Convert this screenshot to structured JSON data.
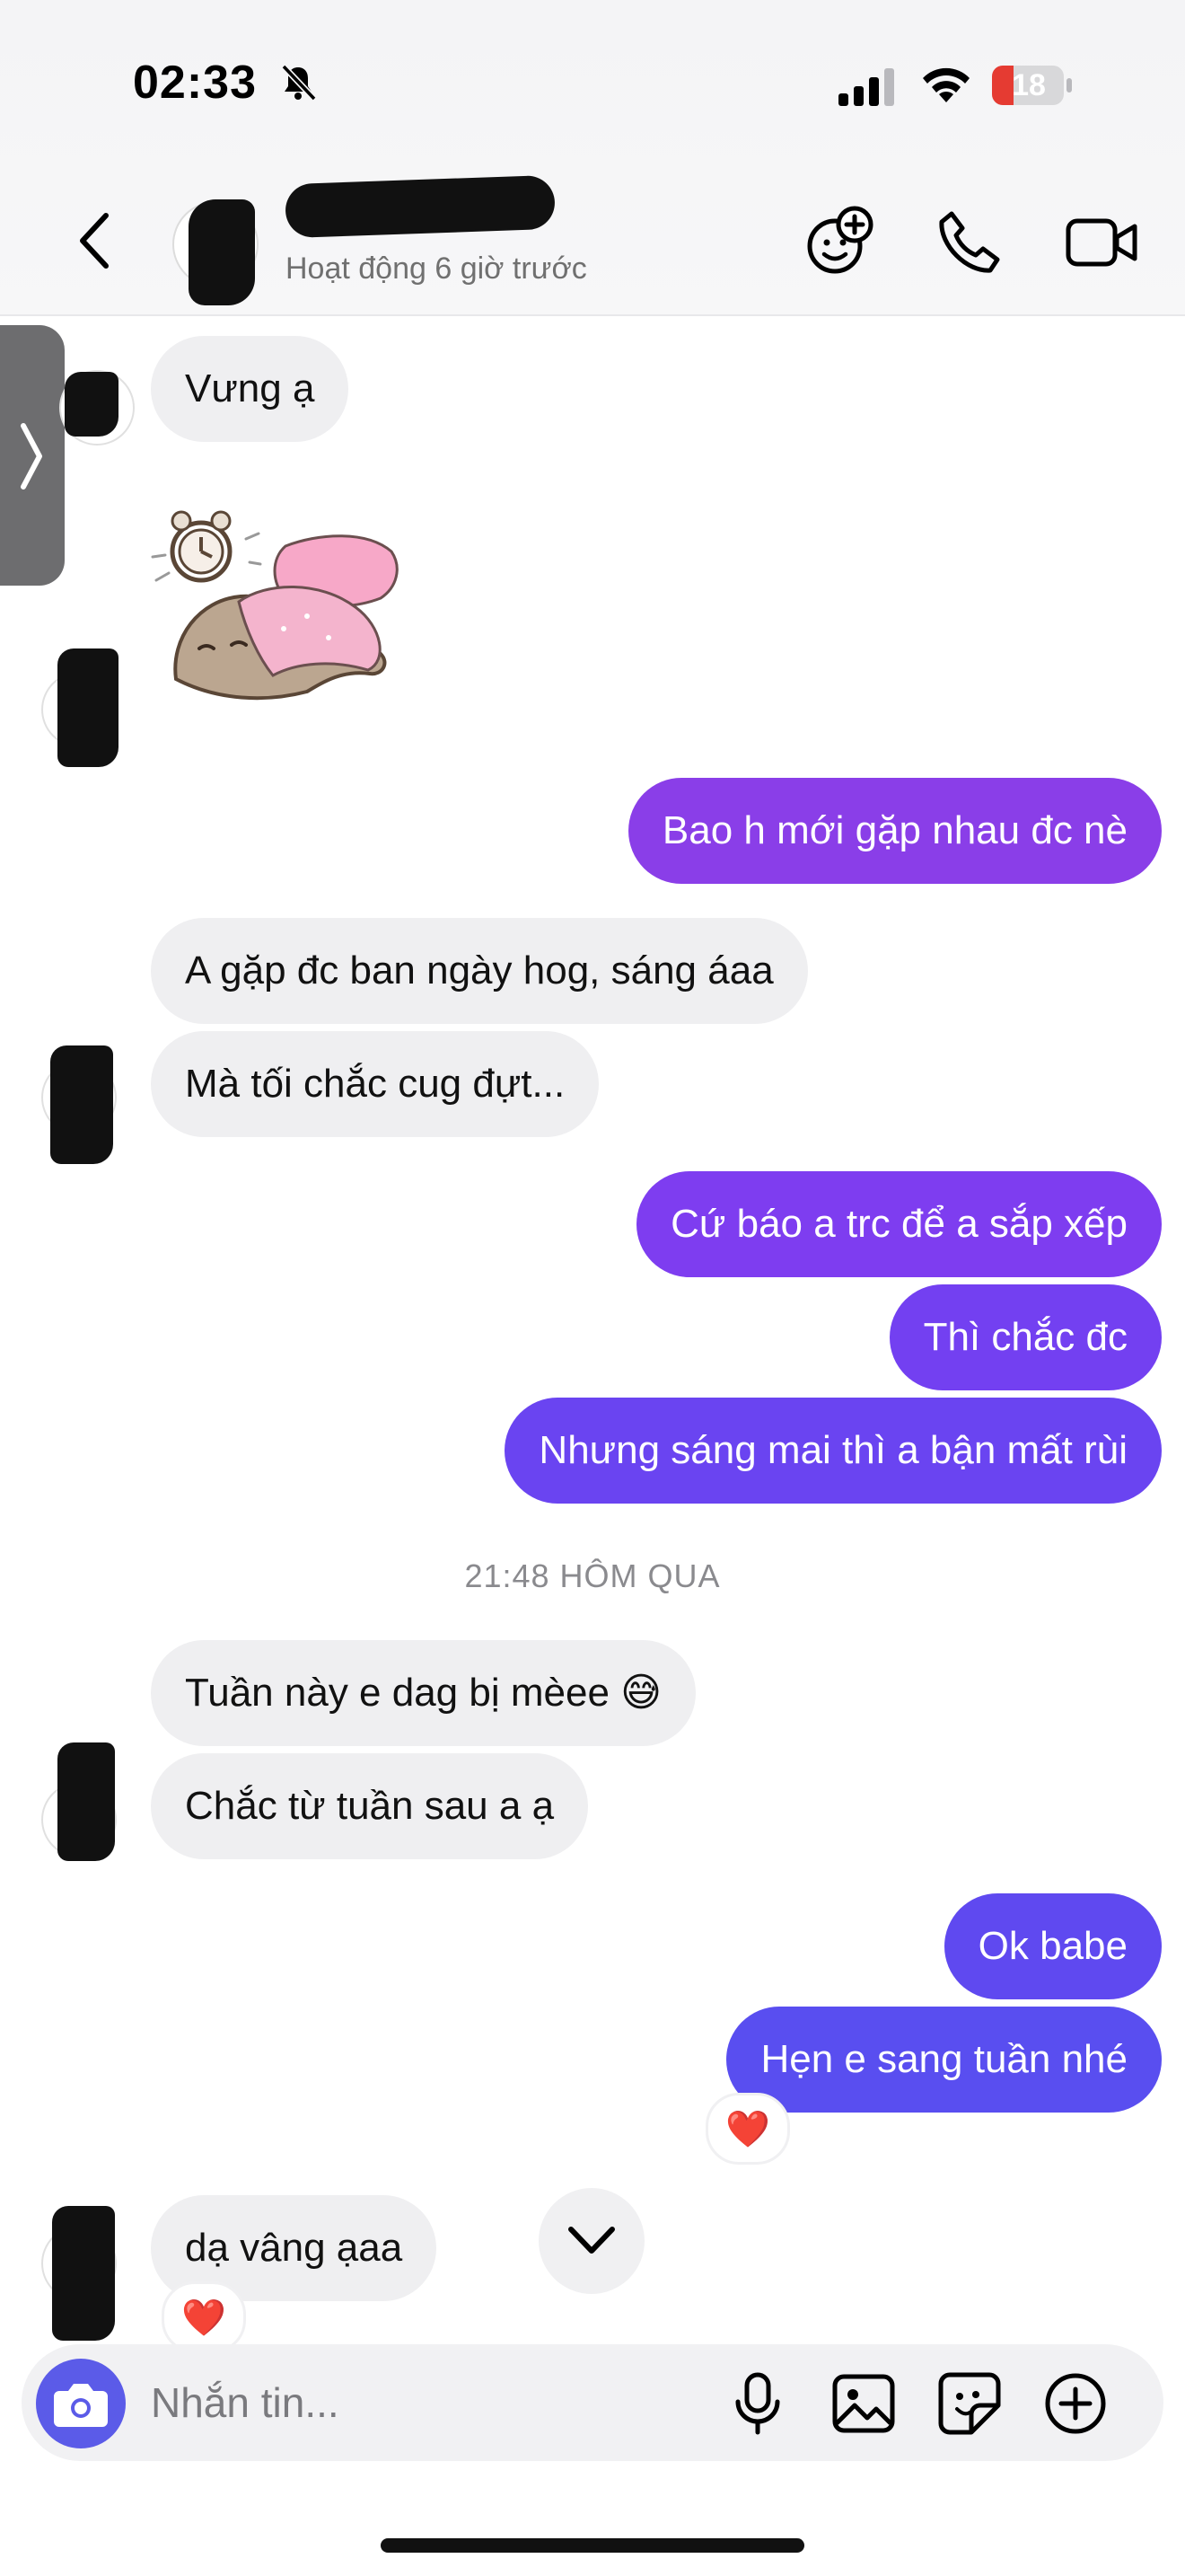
{
  "status_bar": {
    "time": "02:33",
    "battery": "18",
    "icons": [
      "bell-slash-icon",
      "cellular-signal-icon",
      "wifi-icon",
      "battery-icon"
    ]
  },
  "header": {
    "status_text": "Hoạt động 6 giờ trước",
    "icons": [
      "back-chevron-icon",
      "add-effect-icon",
      "phone-icon",
      "video-camera-icon"
    ]
  },
  "colors": {
    "outgoing_top": "#8a3ee8",
    "outgoing_bottom": "#5a4fef",
    "incoming": "#efeff1",
    "camera_button": "#5b5be8",
    "heart": "#e3262b"
  },
  "messages": [
    {
      "from": "them",
      "text": "Vưng ạ"
    },
    {
      "from": "them",
      "type": "sticker",
      "sticker": "sleeping-cat-sticker-icon"
    },
    {
      "from": "me",
      "text": "Bao h mới gặp nhau đc nè"
    },
    {
      "from": "them",
      "text": "A gặp đc ban ngày hog, sáng áaa"
    },
    {
      "from": "them",
      "text": "Mà tối chắc cug đựt..."
    },
    {
      "from": "me",
      "text": "Cứ báo a trc để a sắp xếp"
    },
    {
      "from": "me",
      "text": "Thì chắc đc"
    },
    {
      "from": "me",
      "text": "Nhưng sáng mai thì a bận mất rùi"
    },
    {
      "from": "them",
      "text": "Tuần này e dag bị mèee 😅"
    },
    {
      "from": "them",
      "text": "Chắc từ tuần sau a ạ"
    },
    {
      "from": "me",
      "text": "Ok babe"
    },
    {
      "from": "me",
      "text": "Hẹn e sang tuần nhé",
      "reaction": "❤️"
    },
    {
      "from": "them",
      "text": "dạ vâng ạaa",
      "reaction": "❤️"
    }
  ],
  "timestamp_separator": "21:48 HÔM QUA",
  "composer": {
    "placeholder": "Nhắn tin...",
    "icons": [
      "camera-icon",
      "microphone-icon",
      "image-icon",
      "sticker-icon",
      "plus-circle-icon"
    ]
  }
}
